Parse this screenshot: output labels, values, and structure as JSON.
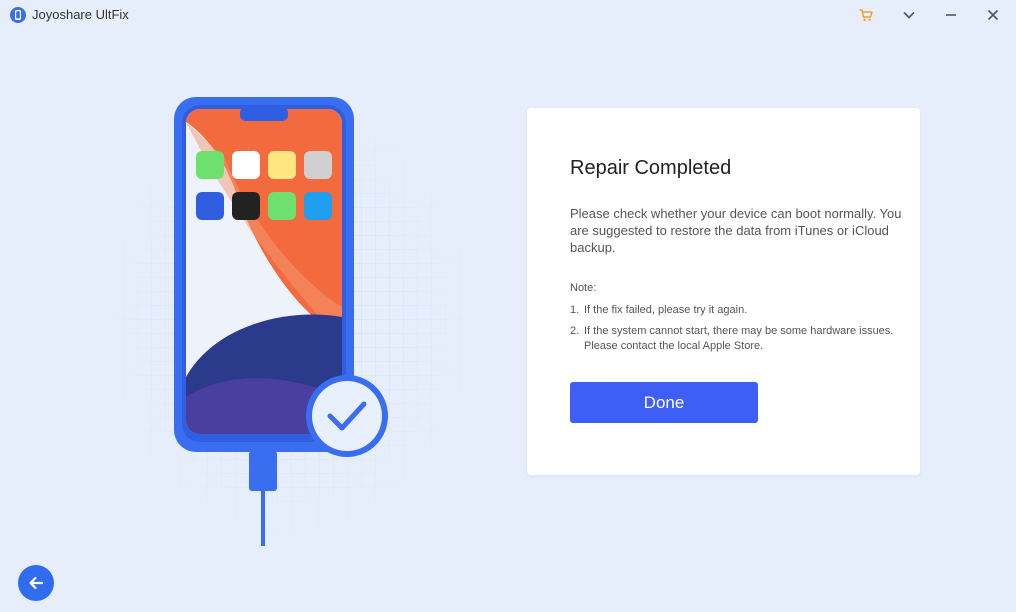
{
  "window": {
    "title": "Joyoshare UltFix",
    "controls": [
      "cart-icon",
      "chevron-down-icon",
      "minimize-icon",
      "close-icon"
    ]
  },
  "colors": {
    "background": "#e6eefc",
    "accent": "#3d5ff5",
    "phone_frame": "#3a6ef0",
    "cart": "#f0a020"
  },
  "card": {
    "title": "Repair Completed",
    "description": "Please check whether your device can boot normally. You are suggested to restore the data from iTunes or iCloud backup.",
    "note_label": "Note:",
    "notes": [
      {
        "num": "1.",
        "text": "If the fix failed, please try it again."
      },
      {
        "num": "2.",
        "text": "If the system cannot start, there may be some hardware issues. Please contact the local Apple Store."
      }
    ],
    "done_label": "Done"
  },
  "footer": {
    "back_icon": "arrow-left-icon"
  }
}
